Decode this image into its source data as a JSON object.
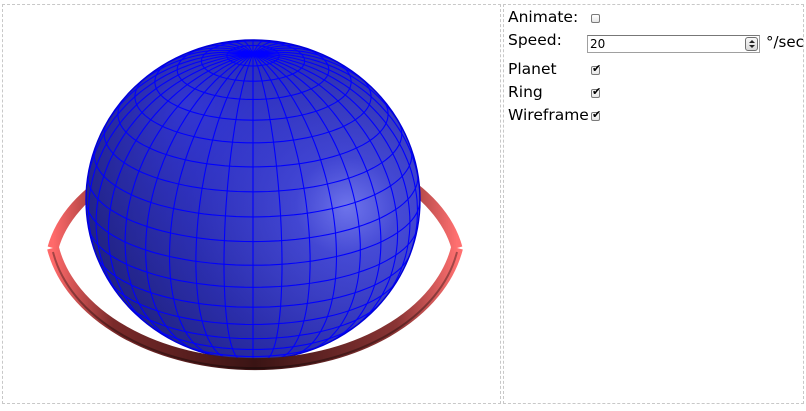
{
  "controls": {
    "animate": {
      "label": "Animate:",
      "checked": false
    },
    "speed": {
      "label": "Speed:",
      "value": "20",
      "unit": "°/sec"
    },
    "planet": {
      "label": "Planet",
      "checked": true
    },
    "ring": {
      "label": "Ring",
      "checked": true
    },
    "wireframe": {
      "label": "Wireframe",
      "checked": true
    }
  },
  "scene": {
    "planet_color": "#2b2bd6",
    "wireframe_color": "#0000ff",
    "ring_color": "#b43c3c"
  }
}
